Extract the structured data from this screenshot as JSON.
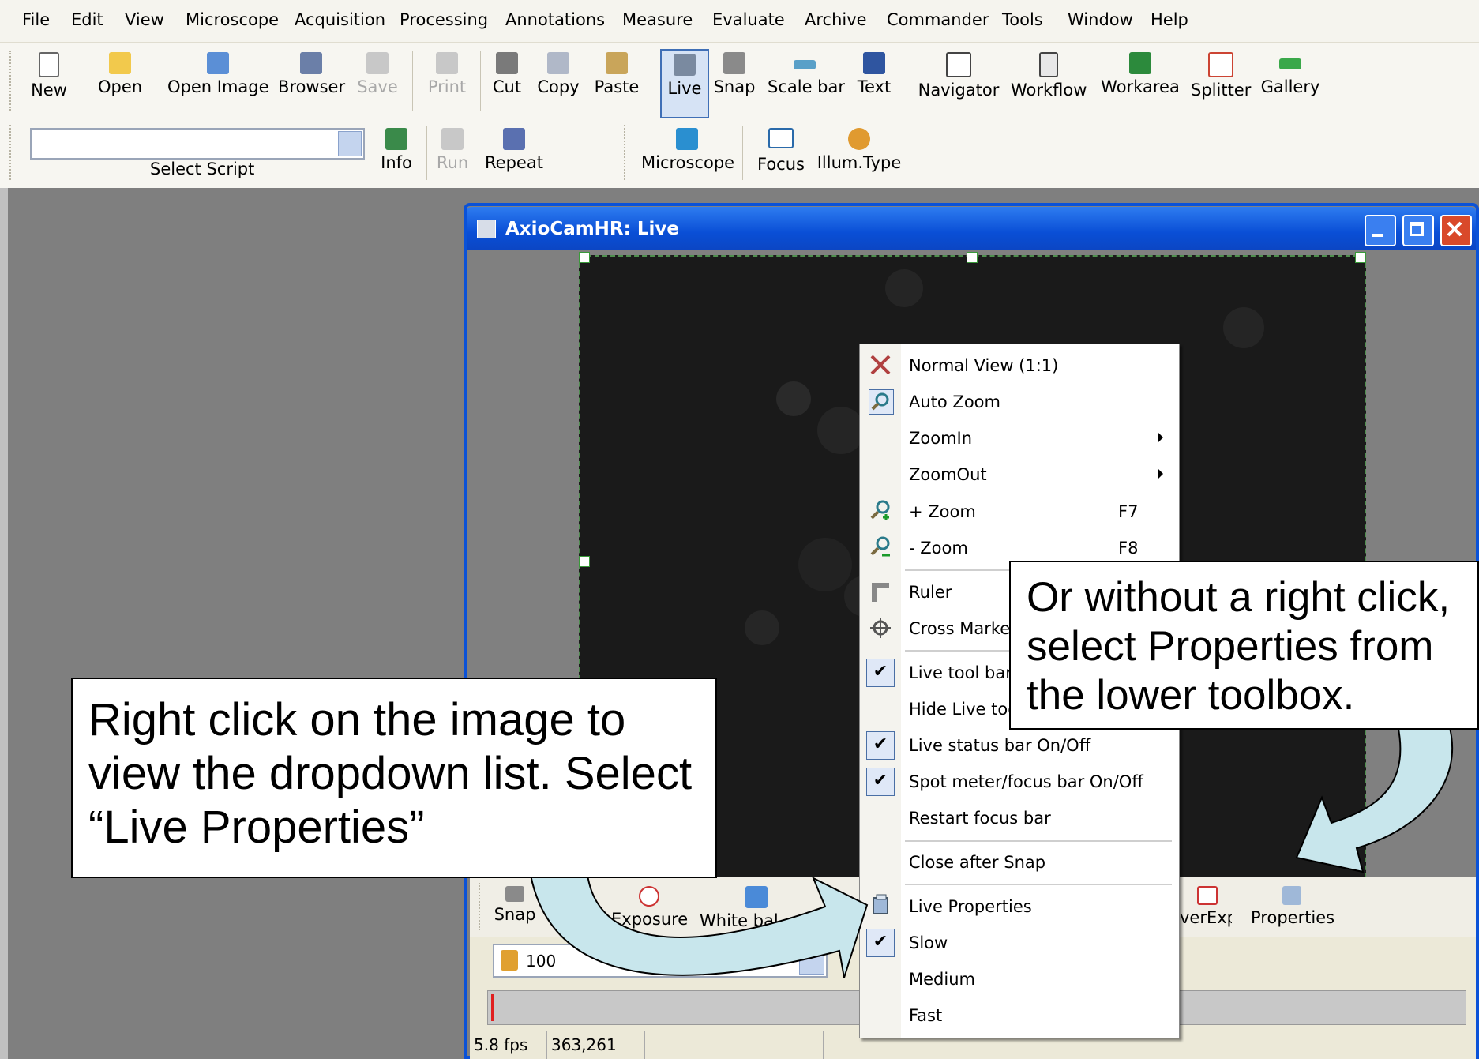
{
  "menubar": {
    "items": [
      "File",
      "Edit",
      "View",
      "Microscope",
      "Acquisition",
      "Processing",
      "Annotations",
      "Measure",
      "Evaluate",
      "Archive",
      "Commander",
      "Tools",
      "Window",
      "Help"
    ]
  },
  "toolbar1": {
    "buttons": [
      "New",
      "Open",
      "Open Image",
      "Browser",
      "Save",
      "Print",
      "Cut",
      "Copy",
      "Paste",
      "Live",
      "Snap",
      "Scale bar",
      "Text",
      "Navigator",
      "Workflow",
      "Workarea",
      "Splitter",
      "Gallery"
    ]
  },
  "toolbar2": {
    "script_label": "Select Script",
    "buttons": [
      "Info",
      "Run",
      "Repeat",
      "Microscope",
      "Focus",
      "Illum.Type"
    ]
  },
  "live_window": {
    "title": "AxioCamHR: Live",
    "toolbar_buttons": [
      "Snap",
      "Exposure",
      "White bal",
      "verExp.",
      "Properties"
    ],
    "select_value": "100",
    "status": {
      "fps": "5.8 fps",
      "coords": "363,261"
    }
  },
  "context_menu": {
    "items": [
      {
        "label": "Normal View (1:1)"
      },
      {
        "label": "Auto Zoom"
      },
      {
        "label": "ZoomIn"
      },
      {
        "label": "ZoomOut"
      },
      {
        "label": "+ Zoom",
        "shortcut": "F7"
      },
      {
        "label": "- Zoom",
        "shortcut": "F8"
      },
      {
        "label": "Ruler"
      },
      {
        "label": "Cross Marker"
      },
      {
        "label": "Live tool bar"
      },
      {
        "label": "Hide Live tool"
      },
      {
        "label": "Live status bar On/Off"
      },
      {
        "label": "Spot meter/focus bar On/Off"
      },
      {
        "label": "Restart focus bar"
      },
      {
        "label": "Close after Snap"
      },
      {
        "label": "Live Properties"
      },
      {
        "label": "Slow"
      },
      {
        "label": "Medium"
      },
      {
        "label": "Fast"
      }
    ]
  },
  "callouts": {
    "left": "Right click on the image to view the dropdown list. Select “Live Properties”",
    "right": "Or without a right click, select Properties from the lower toolbox."
  },
  "colors": {
    "title_bar": "#0a52d8",
    "arrow_fill": "#c8e6ec",
    "workspace": "#7f7f7f"
  }
}
